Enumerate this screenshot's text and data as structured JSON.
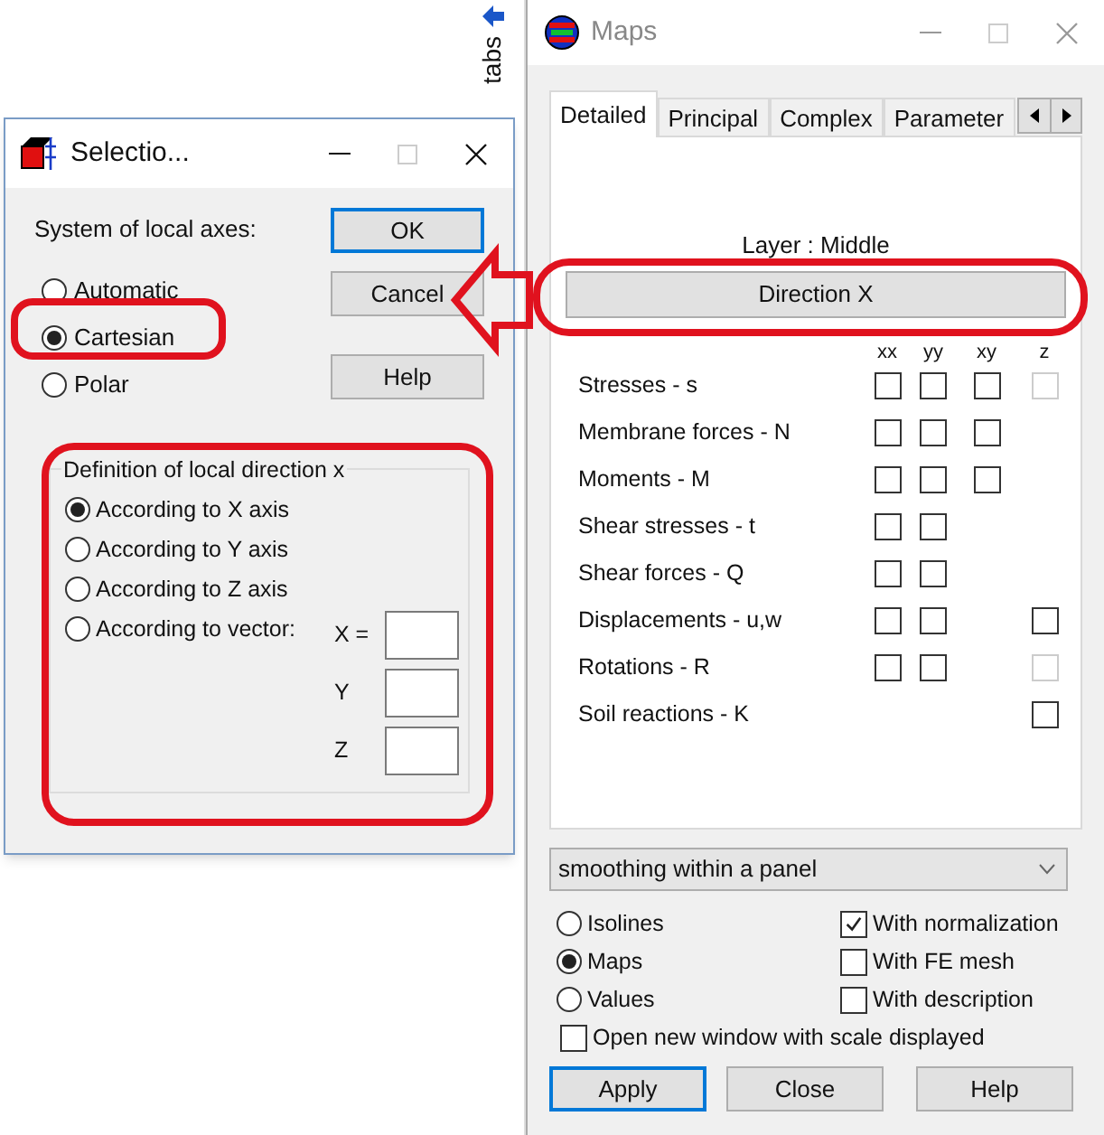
{
  "side_strip": {
    "label": "tabs"
  },
  "selection_dialog": {
    "title": "Selectio...",
    "heading": "System of local axes:",
    "axes": [
      {
        "label": "Automatic",
        "selected": false
      },
      {
        "label": "Cartesian",
        "selected": true
      },
      {
        "label": "Polar",
        "selected": false
      }
    ],
    "buttons": [
      {
        "label": "OK",
        "default": true
      },
      {
        "label": "Cancel",
        "default": false
      },
      {
        "label": "Help",
        "default": false
      }
    ],
    "group": {
      "title": "Definition of local direction x",
      "options": [
        {
          "label": "According to X axis",
          "selected": true
        },
        {
          "label": "According to Y axis",
          "selected": false
        },
        {
          "label": "According to Z axis",
          "selected": false
        },
        {
          "label": "According to vector:",
          "selected": false
        }
      ],
      "vector_fields": [
        {
          "label": "X ="
        },
        {
          "label": "Y"
        },
        {
          "label": "Z"
        }
      ]
    }
  },
  "maps_window": {
    "title": "Maps",
    "tabs": [
      {
        "label": "Detailed",
        "selected": true
      },
      {
        "label": "Principal",
        "selected": false
      },
      {
        "label": "Complex",
        "selected": false
      },
      {
        "label": "Parameter",
        "selected": false
      }
    ],
    "layer": "Layer : Middle",
    "direction_button": "Direction X",
    "columns": [
      "xx",
      "yy",
      "xy",
      "z"
    ],
    "rows": [
      {
        "label": "Stresses - s",
        "cells": [
          {
            "kind": "box",
            "checked": false,
            "disabled": false
          },
          {
            "kind": "box",
            "checked": false,
            "disabled": false
          },
          {
            "kind": "box",
            "checked": false,
            "disabled": false
          },
          {
            "kind": "box",
            "checked": false,
            "disabled": true
          }
        ]
      },
      {
        "label": "Membrane forces - N",
        "cells": [
          {
            "kind": "box",
            "checked": false,
            "disabled": false
          },
          {
            "kind": "box",
            "checked": false,
            "disabled": false
          },
          {
            "kind": "box",
            "checked": false,
            "disabled": false
          },
          {
            "kind": "none"
          }
        ]
      },
      {
        "label": "Moments - M",
        "cells": [
          {
            "kind": "box",
            "checked": false,
            "disabled": false
          },
          {
            "kind": "box",
            "checked": false,
            "disabled": false
          },
          {
            "kind": "box",
            "checked": false,
            "disabled": false
          },
          {
            "kind": "none"
          }
        ]
      },
      {
        "label": "Shear stresses - t",
        "cells": [
          {
            "kind": "box",
            "checked": false,
            "disabled": false
          },
          {
            "kind": "box",
            "checked": false,
            "disabled": false
          },
          {
            "kind": "none"
          },
          {
            "kind": "none"
          }
        ]
      },
      {
        "label": "Shear forces - Q",
        "cells": [
          {
            "kind": "box",
            "checked": false,
            "disabled": false
          },
          {
            "kind": "box",
            "checked": false,
            "disabled": false
          },
          {
            "kind": "none"
          },
          {
            "kind": "none"
          }
        ]
      },
      {
        "label": "Displacements - u,w",
        "cells": [
          {
            "kind": "box",
            "checked": false,
            "disabled": false
          },
          {
            "kind": "box",
            "checked": false,
            "disabled": false
          },
          {
            "kind": "none"
          },
          {
            "kind": "box",
            "checked": false,
            "disabled": false
          }
        ]
      },
      {
        "label": "Rotations - R",
        "cells": [
          {
            "kind": "box",
            "checked": false,
            "disabled": false
          },
          {
            "kind": "box",
            "checked": false,
            "disabled": false
          },
          {
            "kind": "none"
          },
          {
            "kind": "box",
            "checked": false,
            "disabled": true
          }
        ]
      },
      {
        "label": "Soil reactions - K",
        "cells": [
          {
            "kind": "none"
          },
          {
            "kind": "none"
          },
          {
            "kind": "none"
          },
          {
            "kind": "box",
            "checked": false,
            "disabled": false
          }
        ]
      }
    ],
    "smoothing": "smoothing within a panel",
    "display_modes": [
      {
        "label": "Isolines",
        "selected": false
      },
      {
        "label": "Maps",
        "selected": true
      },
      {
        "label": "Values",
        "selected": false
      }
    ],
    "options": [
      {
        "label": "With normalization",
        "checked": true
      },
      {
        "label": "With FE mesh",
        "checked": false
      },
      {
        "label": "With description",
        "checked": false
      }
    ],
    "scale_option": {
      "label": "Open new window with scale displayed",
      "checked": false
    },
    "buttons": [
      {
        "label": "Apply",
        "default": true
      },
      {
        "label": "Close",
        "default": false
      },
      {
        "label": "Help",
        "default": false
      }
    ]
  }
}
